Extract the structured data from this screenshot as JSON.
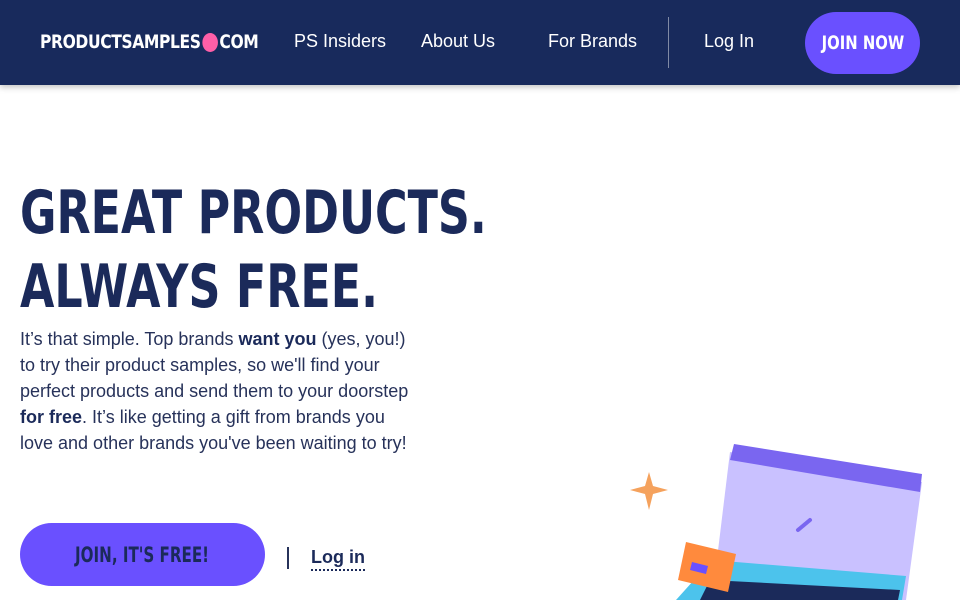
{
  "header": {
    "logo": {
      "left": "PRODUCTSAMPLES",
      "right": "COM"
    },
    "nav": [
      {
        "label": "PS Insiders"
      },
      {
        "label": "About Us"
      },
      {
        "label": "For Brands"
      },
      {
        "label": "Log In"
      }
    ],
    "join_button": "JOIN NOW"
  },
  "hero": {
    "title_line1": "GREAT PRODUCTS.",
    "title_line2": "ALWAYS FREE.",
    "body": {
      "p1": "It’s that simple. Top brands ",
      "b1": "want you",
      "p2": " (yes, you!) to try their product samples, so we'll find your perfect products and send them to your doorstep ",
      "b2": "for free",
      "p3": ". It’s like getting a gift from brands you love and other brands you've been waiting to try!"
    },
    "cta_join": "JOIN, IT'S FREE!",
    "cta_separator": "|",
    "cta_login": "Log in"
  },
  "colors": {
    "navbar": "#182a5c",
    "accent": "#6a50ff",
    "logo_dot": "#ff5fa8",
    "sparkle": "#f5a25d",
    "box_lid": "#7a66f0",
    "box_body": "#c9c1ff",
    "box_base": "#4cc3ec"
  },
  "icons": {
    "logo_dot": "pink-circle",
    "sparkle": "four-point-star",
    "illustration": "open-sample-box"
  }
}
